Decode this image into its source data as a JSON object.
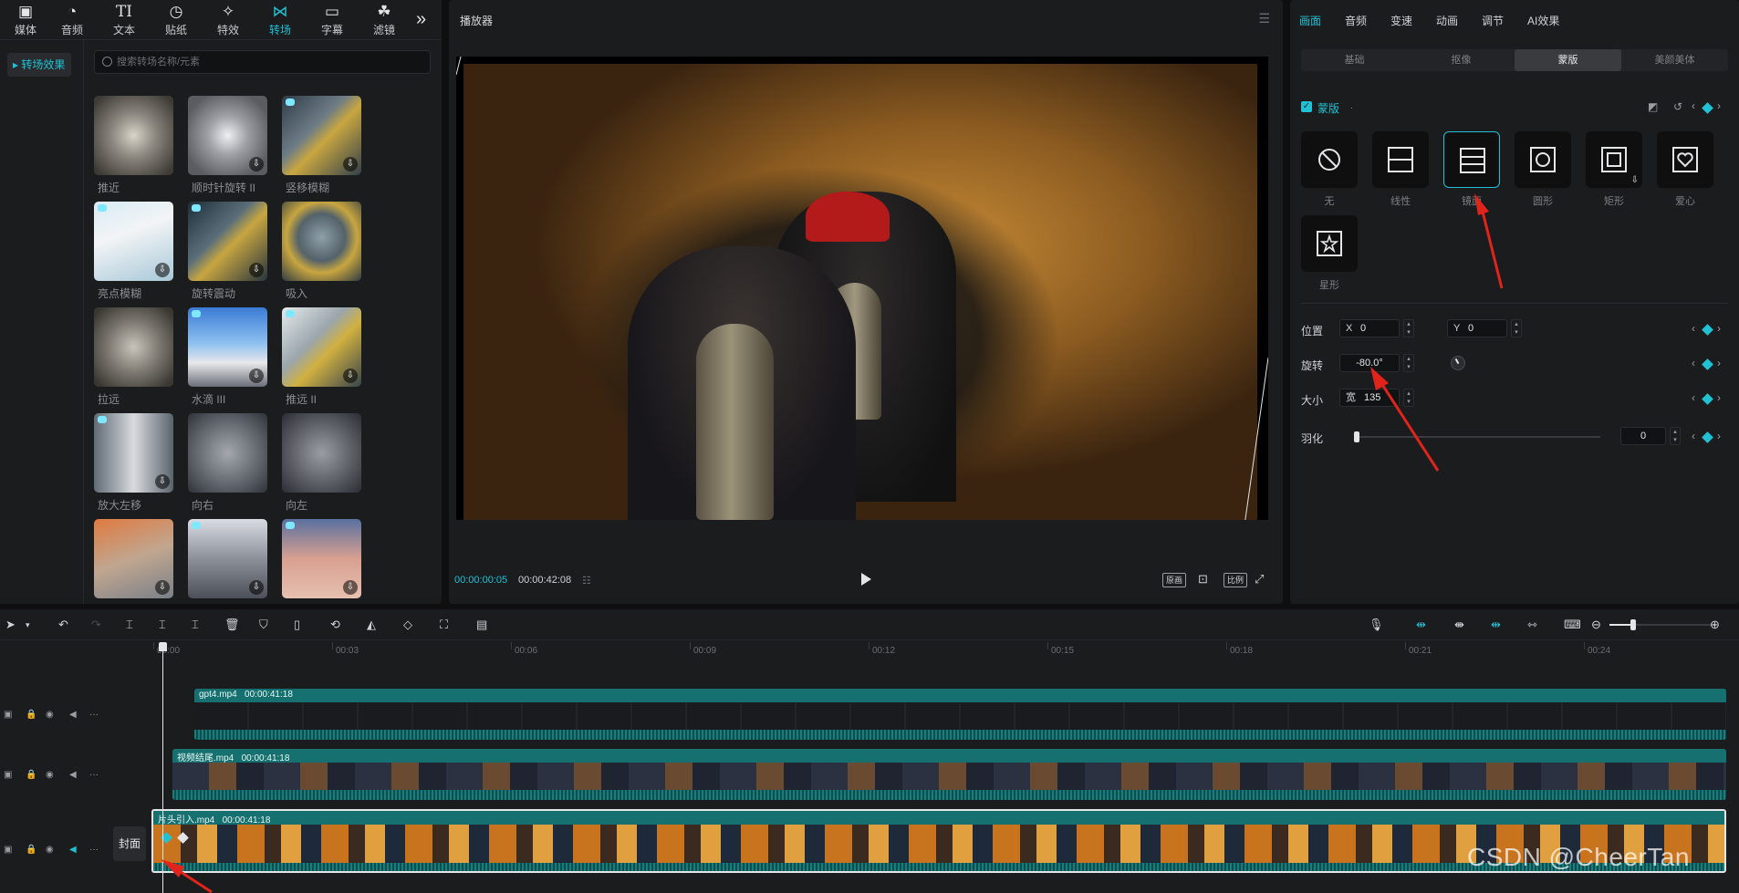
{
  "toolbar": {
    "items": [
      {
        "label": "媒体",
        "icon": "media-icon"
      },
      {
        "label": "音频",
        "icon": "audio-icon"
      },
      {
        "label": "文本",
        "icon": "text-icon"
      },
      {
        "label": "贴纸",
        "icon": "sticker-icon"
      },
      {
        "label": "特效",
        "icon": "effects-icon"
      },
      {
        "label": "转场",
        "icon": "transition-icon"
      },
      {
        "label": "字幕",
        "icon": "caption-icon"
      },
      {
        "label": "滤镜",
        "icon": "filter-icon"
      }
    ],
    "active_index": 5,
    "text_glyph": "TI"
  },
  "sidebar": {
    "category": "▸ 转场效果"
  },
  "search": {
    "placeholder": "搜索转场名称/元素"
  },
  "transitions": [
    {
      "label": "推近",
      "download": false
    },
    {
      "label": "顺时针旋转 II",
      "download": true
    },
    {
      "label": "竖移模糊",
      "download": true
    },
    {
      "label": "亮点模糊",
      "download": true
    },
    {
      "label": "旋转震动",
      "download": true
    },
    {
      "label": "吸入",
      "download": false
    },
    {
      "label": "拉远",
      "download": false
    },
    {
      "label": "水滴 III",
      "download": true
    },
    {
      "label": "推远 II",
      "download": true
    },
    {
      "label": "放大左移",
      "download": true
    },
    {
      "label": "向右",
      "download": false
    },
    {
      "label": "向左",
      "download": false
    },
    {
      "label": "",
      "download": true
    },
    {
      "label": "",
      "download": true
    },
    {
      "label": "",
      "download": true
    }
  ],
  "player": {
    "title": "播放器",
    "current_time": "00:00:00:05",
    "total_time": "00:00:42:08",
    "grid_glyph": "☷",
    "buttons": {
      "quality": "原画",
      "ratio": "比例"
    }
  },
  "props": {
    "tabs": [
      "画面",
      "音频",
      "变速",
      "动画",
      "调节",
      "AI效果"
    ],
    "active_tab": 0,
    "subtabs": [
      "基础",
      "抠像",
      "蒙版",
      "美颜美体"
    ],
    "active_subtab": 2,
    "mask": {
      "title": "蒙版",
      "shapes": [
        "无",
        "线性",
        "镜面",
        "圆形",
        "矩形",
        "爱心",
        "星形"
      ],
      "active_shape": 2
    },
    "position": {
      "label": "位置",
      "x_label": "X",
      "x": "0",
      "y_label": "Y",
      "y": "0"
    },
    "rotation": {
      "label": "旋转",
      "value": "-80.0°"
    },
    "size": {
      "label": "大小",
      "width_label": "宽",
      "width": "135"
    },
    "feather": {
      "label": "羽化",
      "value": "0"
    }
  },
  "timeline": {
    "ruler_labels": [
      "00:00",
      "00:03",
      "00:06",
      "00:09",
      "00:12",
      "00:15",
      "00:18",
      "00:21",
      "00:24"
    ],
    "tracks": [
      {
        "name": "gpt4.mp4",
        "duration": "00:00:41:18"
      },
      {
        "name": "视频结尾.mp4",
        "duration": "00:00:41:18"
      },
      {
        "name": "片头引入.mp4",
        "duration": "00:00:41:18"
      }
    ],
    "cover_label": "封面"
  },
  "watermark": "CSDN @CheerTan",
  "colors": {
    "accent": "#20c1d4",
    "panel": "#1b1c1e",
    "clip": "#0d5a5c",
    "arrow": "#e0241b"
  }
}
